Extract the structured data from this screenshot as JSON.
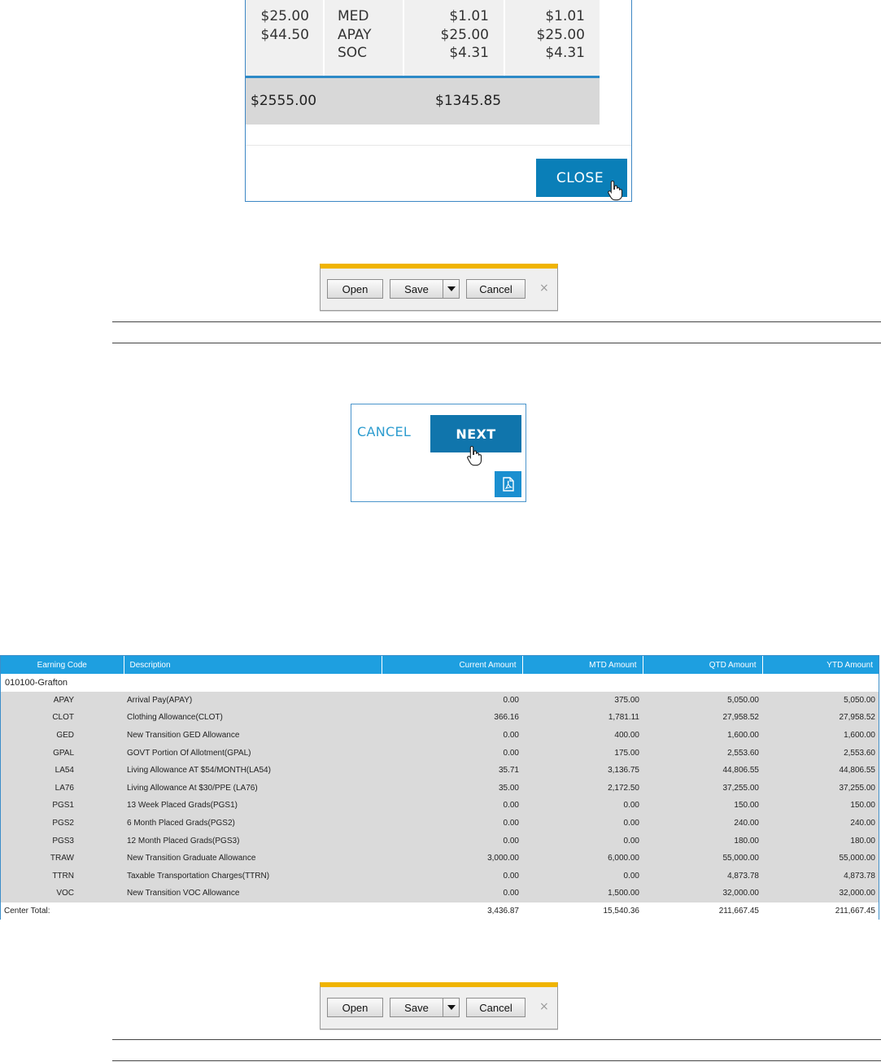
{
  "modal": {
    "rows": {
      "col1": "$25.00\n$44.50",
      "col2": "MED\nAPAY\nSOC",
      "col3": "$1.01\n$25.00\n$4.31",
      "col4": "$1.01\n$25.00\n$4.31"
    },
    "totals": {
      "col1": "$2555.00",
      "col3": "$1345.85"
    },
    "close_label": "CLOSE"
  },
  "toolbar1": {
    "open_label": "Open",
    "save_label": "Save",
    "cancel_label": "Cancel",
    "close_glyph": "×"
  },
  "wizard": {
    "cancel_label": "CANCEL",
    "next_label": "NEXT",
    "pdf_icon": "pdf-icon"
  },
  "earnings": {
    "headers": [
      "Earning Code",
      "Description",
      "Current Amount",
      "MTD Amount",
      "QTD Amount",
      "YTD Amount"
    ],
    "group": "010100-Grafton",
    "rows": [
      {
        "code": "APAY",
        "desc": "Arrival Pay(APAY)",
        "cur": "0.00",
        "mtd": "375.00",
        "qtd": "5,050.00",
        "ytd": "5,050.00"
      },
      {
        "code": "CLOT",
        "desc": "Clothing Allowance(CLOT)",
        "cur": "366.16",
        "mtd": "1,781.11",
        "qtd": "27,958.52",
        "ytd": "27,958.52"
      },
      {
        "code": "GED",
        "desc": "New Transition GED Allowance",
        "cur": "0.00",
        "mtd": "400.00",
        "qtd": "1,600.00",
        "ytd": "1,600.00"
      },
      {
        "code": "GPAL",
        "desc": "GOVT Portion Of Allotment(GPAL)",
        "cur": "0.00",
        "mtd": "175.00",
        "qtd": "2,553.60",
        "ytd": "2,553.60"
      },
      {
        "code": "LA54",
        "desc": "Living Allowance AT $54/MONTH(LA54)",
        "cur": "35.71",
        "mtd": "3,136.75",
        "qtd": "44,806.55",
        "ytd": "44,806.55"
      },
      {
        "code": "LA76",
        "desc": "Living Allowance At $30/PPE (LA76)",
        "cur": "35.00",
        "mtd": "2,172.50",
        "qtd": "37,255.00",
        "ytd": "37,255.00"
      },
      {
        "code": "PGS1",
        "desc": "13 Week Placed Grads(PGS1)",
        "cur": "0.00",
        "mtd": "0.00",
        "qtd": "150.00",
        "ytd": "150.00"
      },
      {
        "code": "PGS2",
        "desc": "6 Month Placed Grads(PGS2)",
        "cur": "0.00",
        "mtd": "0.00",
        "qtd": "240.00",
        "ytd": "240.00"
      },
      {
        "code": "PGS3",
        "desc": "12 Month Placed Grads(PGS3)",
        "cur": "0.00",
        "mtd": "0.00",
        "qtd": "180.00",
        "ytd": "180.00"
      },
      {
        "code": "TRAW",
        "desc": "New Transition Graduate Allowance",
        "cur": "3,000.00",
        "mtd": "6,000.00",
        "qtd": "55,000.00",
        "ytd": "55,000.00"
      },
      {
        "code": "TTRN",
        "desc": "Taxable Transportation Charges(TTRN)",
        "cur": "0.00",
        "mtd": "0.00",
        "qtd": "4,873.78",
        "ytd": "4,873.78"
      },
      {
        "code": "VOC",
        "desc": "New Transition VOC Allowance",
        "cur": "0.00",
        "mtd": "1,500.00",
        "qtd": "32,000.00",
        "ytd": "32,000.00"
      }
    ],
    "total": {
      "label": "Center Total:",
      "cur": "3,436.87",
      "mtd": "15,540.36",
      "qtd": "211,667.45",
      "ytd": "211,667.45"
    }
  },
  "toolbar2": {
    "open_label": "Open",
    "save_label": "Save",
    "cancel_label": "Cancel",
    "close_glyph": "×"
  }
}
